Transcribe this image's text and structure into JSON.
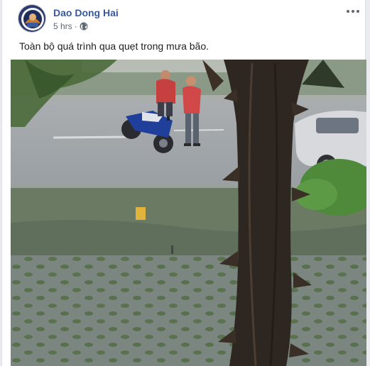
{
  "post": {
    "author": "Dao Dong Hai",
    "time": "5 hrs",
    "separator": "·",
    "text": "Toàn bộ quá trình qua quẹt trong mưa bão."
  },
  "icons": {
    "privacy": "globe-icon",
    "options": "more-options-icon"
  },
  "colors": {
    "author_link": "#385898",
    "page_bg": "#e9ebee",
    "card_bg": "#ffffff"
  }
}
